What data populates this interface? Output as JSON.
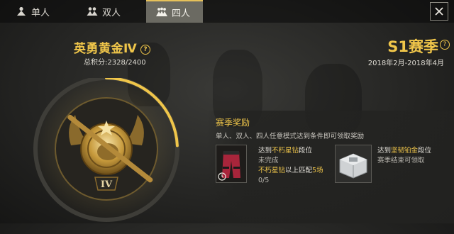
{
  "tabs": [
    {
      "label": "单人",
      "active": false
    },
    {
      "label": "双人",
      "active": false
    },
    {
      "label": "四人",
      "active": true
    }
  ],
  "rank": {
    "title": "英勇黄金Ⅳ",
    "score_label": "总积分:",
    "score_value": "2328/2400",
    "score_progress": 0.97,
    "badge_numeral": "IV"
  },
  "season": {
    "name": "S1赛季",
    "dates": "2018年2月-2018年4月"
  },
  "rewards": {
    "title": "赛季奖励",
    "description": "单人、双人、四人任意模式达到条件即可领取奖励",
    "items": [
      {
        "line1_prefix": "达到",
        "line1_highlight": "不朽星钻",
        "line1_suffix": "段位",
        "status": "未完成",
        "req_highlight": "不朽星钻",
        "req_mid": "以上匹配",
        "req_count": "5场",
        "progress_text": "0/5"
      },
      {
        "line1_prefix": "达到",
        "line1_highlight": "坚韧铂金",
        "line1_suffix": "段位",
        "status": "赛季结束可领取"
      }
    ]
  },
  "colors": {
    "accent": "#f0c64a",
    "tab_active_bg": "#6b6a62",
    "panel_bg": "#232321"
  }
}
